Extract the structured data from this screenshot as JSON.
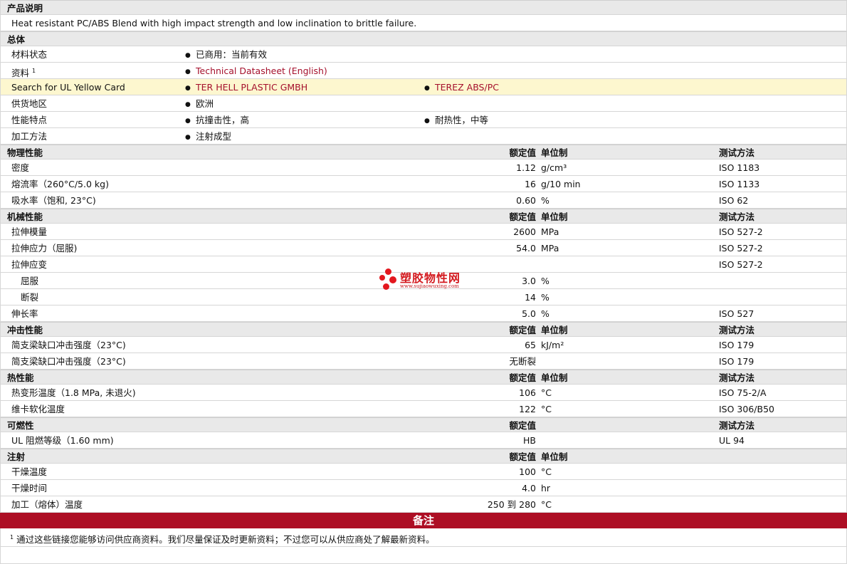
{
  "sections": [
    {
      "type": "section",
      "title": "产品说明"
    },
    {
      "type": "text",
      "text": "Heat resistant PC/ABS Blend with high impact strength and low inclination to brittle failure."
    },
    {
      "type": "section",
      "title": "总体"
    },
    {
      "type": "general",
      "label": "材料状态",
      "items": [
        {
          "text": "已商用：当前有效",
          "link": false
        }
      ]
    },
    {
      "type": "general",
      "label": "资料",
      "sup": "1",
      "items": [
        {
          "text": "Technical Datasheet (English)",
          "link": true
        }
      ]
    },
    {
      "type": "general",
      "label": "Search for UL Yellow Card",
      "highlight": true,
      "items": [
        {
          "text": "TER HELL PLASTIC GMBH",
          "link": true
        },
        {
          "text": "TEREZ ABS/PC",
          "link": true
        }
      ]
    },
    {
      "type": "general",
      "label": "供货地区",
      "items": [
        {
          "text": "欧洲",
          "link": false
        }
      ]
    },
    {
      "type": "general",
      "label": "性能特点",
      "items": [
        {
          "text": "抗撞击性，高",
          "link": false
        },
        {
          "text": "耐热性，中等",
          "link": false
        }
      ]
    },
    {
      "type": "general",
      "label": "加工方法",
      "items": [
        {
          "text": "注射成型",
          "link": false
        }
      ]
    },
    {
      "type": "section",
      "title": "物理性能",
      "val": "额定值",
      "unit": "单位制",
      "test": "测试方法"
    },
    {
      "type": "prop",
      "label": "密度",
      "val": "1.12",
      "unit": "g/cm³",
      "test": "ISO 1183"
    },
    {
      "type": "prop",
      "label": "熔流率（260°C/5.0 kg)",
      "val": "16",
      "unit": "g/10 min",
      "test": "ISO 1133"
    },
    {
      "type": "prop",
      "label": "吸水率（饱和, 23°C)",
      "val": "0.60",
      "unit": "%",
      "test": "ISO 62"
    },
    {
      "type": "section",
      "title": "机械性能",
      "val": "额定值",
      "unit": "单位制",
      "test": "测试方法"
    },
    {
      "type": "prop",
      "label": "拉伸模量",
      "val": "2600",
      "unit": "MPa",
      "test": "ISO 527-2"
    },
    {
      "type": "prop",
      "label": "拉伸应力（屈服)",
      "val": "54.0",
      "unit": "MPa",
      "test": "ISO 527-2"
    },
    {
      "type": "prop",
      "label": "拉伸应变",
      "val": "",
      "unit": "",
      "test": "ISO 527-2"
    },
    {
      "type": "prop",
      "label": "屈服",
      "sub": true,
      "val": "3.0",
      "unit": "%",
      "test": ""
    },
    {
      "type": "prop",
      "label": "断裂",
      "sub": true,
      "val": "14",
      "unit": "%",
      "test": ""
    },
    {
      "type": "prop",
      "label": "伸长率",
      "val": "5.0",
      "unit": "%",
      "test": "ISO 527"
    },
    {
      "type": "section",
      "title": "冲击性能",
      "val": "额定值",
      "unit": "单位制",
      "test": "测试方法"
    },
    {
      "type": "prop",
      "label": "简支梁缺口冲击强度（23°C)",
      "val": "65",
      "unit": "kJ/m²",
      "test": "ISO 179"
    },
    {
      "type": "prop",
      "label": "简支梁缺口冲击强度（23°C)",
      "val": "无断裂",
      "unit": "",
      "test": "ISO 179"
    },
    {
      "type": "section",
      "title": "热性能",
      "val": "额定值",
      "unit": "单位制",
      "test": "测试方法"
    },
    {
      "type": "prop",
      "label": "热变形温度（1.8 MPa, 未退火)",
      "val": "106",
      "unit": "°C",
      "test": "ISO 75-2/A"
    },
    {
      "type": "prop",
      "label": "维卡软化温度",
      "val": "122",
      "unit": "°C",
      "test": "ISO 306/B50"
    },
    {
      "type": "section",
      "title": "可燃性",
      "val": "额定值",
      "unit": "",
      "test": "测试方法"
    },
    {
      "type": "prop",
      "label": "UL 阻燃等级（1.60 mm)",
      "val": "HB",
      "unit": "",
      "test": "UL 94"
    },
    {
      "type": "section",
      "title": "注射",
      "val": "额定值",
      "unit": "单位制",
      "test": ""
    },
    {
      "type": "prop",
      "label": "干燥温度",
      "val": "100",
      "unit": "°C",
      "test": ""
    },
    {
      "type": "prop",
      "label": "干燥时间",
      "val": "4.0",
      "unit": "hr",
      "test": ""
    },
    {
      "type": "prop",
      "label": "加工（熔体）温度",
      "val": "250 到  280",
      "unit": "°C",
      "test": ""
    }
  ],
  "notes": {
    "title": "备注",
    "sup": "1",
    "text": "通过这些链接您能够访问供应商资料。我们尽量保证及时更新资料；不过您可以从供应商处了解最新资料。"
  },
  "watermark": {
    "name": "塑胶物性网",
    "url": "www.sujiaowuxing.com",
    "color": "#e3171e"
  }
}
